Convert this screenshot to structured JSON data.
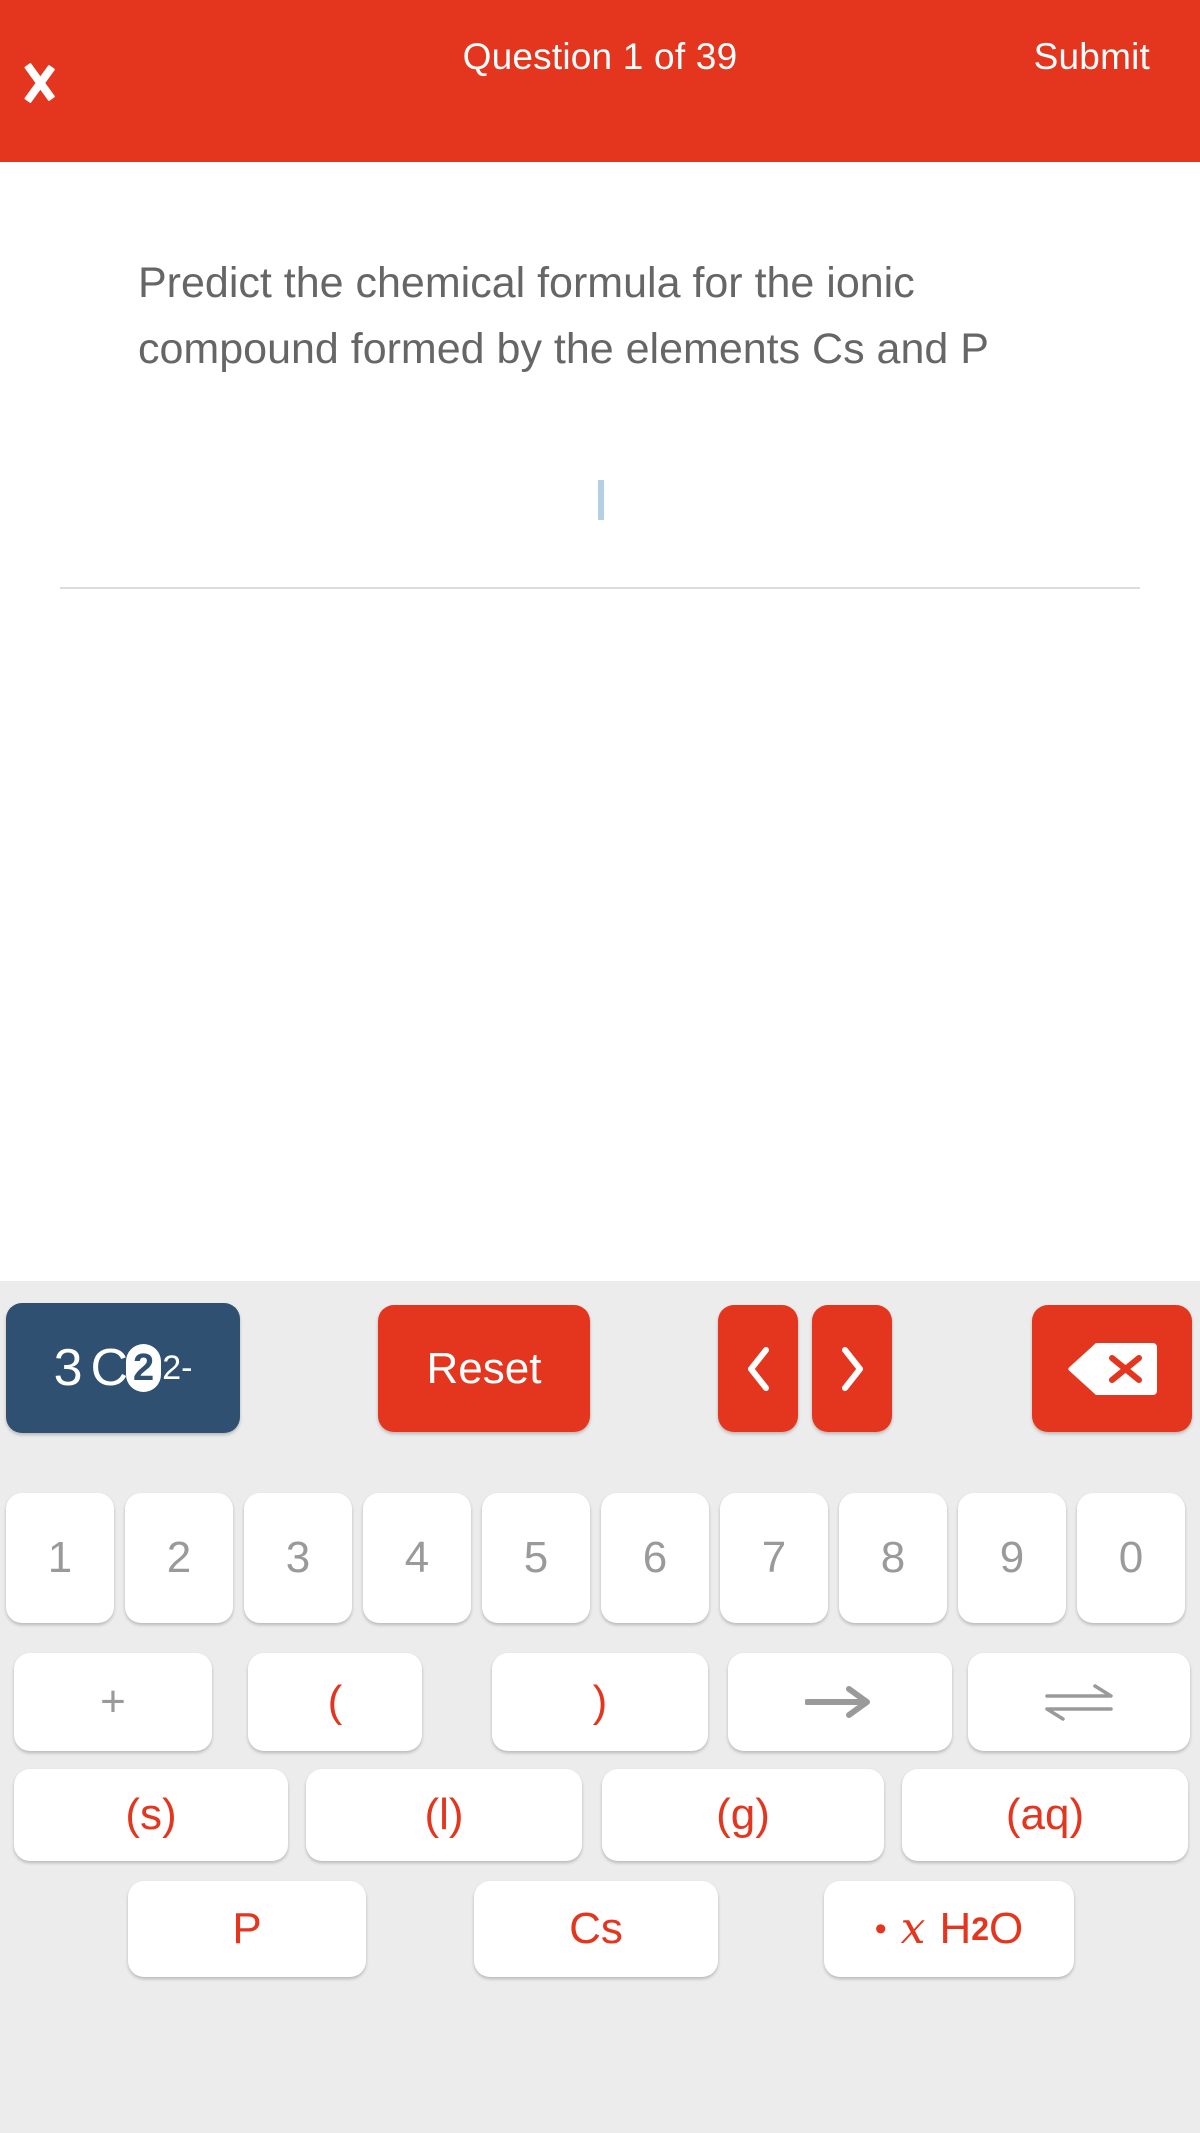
{
  "header": {
    "back_icon": "chevron-left-icon",
    "title": "Question 1 of 39",
    "submit_label": "Submit",
    "background_color": "#e4361f",
    "text_color": "#ffffff"
  },
  "question": {
    "prompt": "Predict the chemical formula for the ionic compound formed by the elements Cs and P",
    "answer_value": "",
    "caret_color": "#b5d0e5",
    "text_color": "#666666"
  },
  "keyboard": {
    "background_color": "#ececec",
    "accent_color": "#e4361f",
    "display_color": "#2f5071",
    "display": {
      "coefficient": "3",
      "symbol": "C",
      "subscript": "2",
      "superscript": "2-",
      "full_text": "3 C2 2-"
    },
    "reset_label": "Reset",
    "nav_prev_icon": "chevron-left-icon",
    "nav_prev_label": "‹",
    "nav_next_icon": "chevron-right-icon",
    "nav_next_label": "›",
    "backspace_icon": "backspace-delete-icon",
    "numbers": [
      "1",
      "2",
      "3",
      "4",
      "5",
      "6",
      "7",
      "8",
      "9",
      "0"
    ],
    "symbols": [
      {
        "label": "+",
        "name": "plus-key",
        "color": "#9a9a9a"
      },
      {
        "label": "(",
        "name": "open-paren-key",
        "color": "#e4361f"
      },
      {
        "label": ")",
        "name": "close-paren-key",
        "color": "#e4361f"
      },
      {
        "label": "→",
        "name": "reaction-arrow-key",
        "color": "#9a9a9a"
      },
      {
        "label": "⇌",
        "name": "equilibrium-arrow-key",
        "color": "#9a9a9a"
      }
    ],
    "states": [
      {
        "label": "(s)",
        "name": "state-solid-key"
      },
      {
        "label": "(l)",
        "name": "state-liquid-key"
      },
      {
        "label": "(g)",
        "name": "state-gas-key"
      },
      {
        "label": "(aq)",
        "name": "state-aqueous-key"
      }
    ],
    "elements": [
      {
        "label": "P",
        "name": "element-p-key"
      },
      {
        "label": "Cs",
        "name": "element-cs-key"
      }
    ],
    "hydrate": {
      "dot": "•",
      "variable": "x",
      "formula_main": "H",
      "formula_sub": "2",
      "formula_tail": "O",
      "full_text": "• x H2O"
    }
  }
}
